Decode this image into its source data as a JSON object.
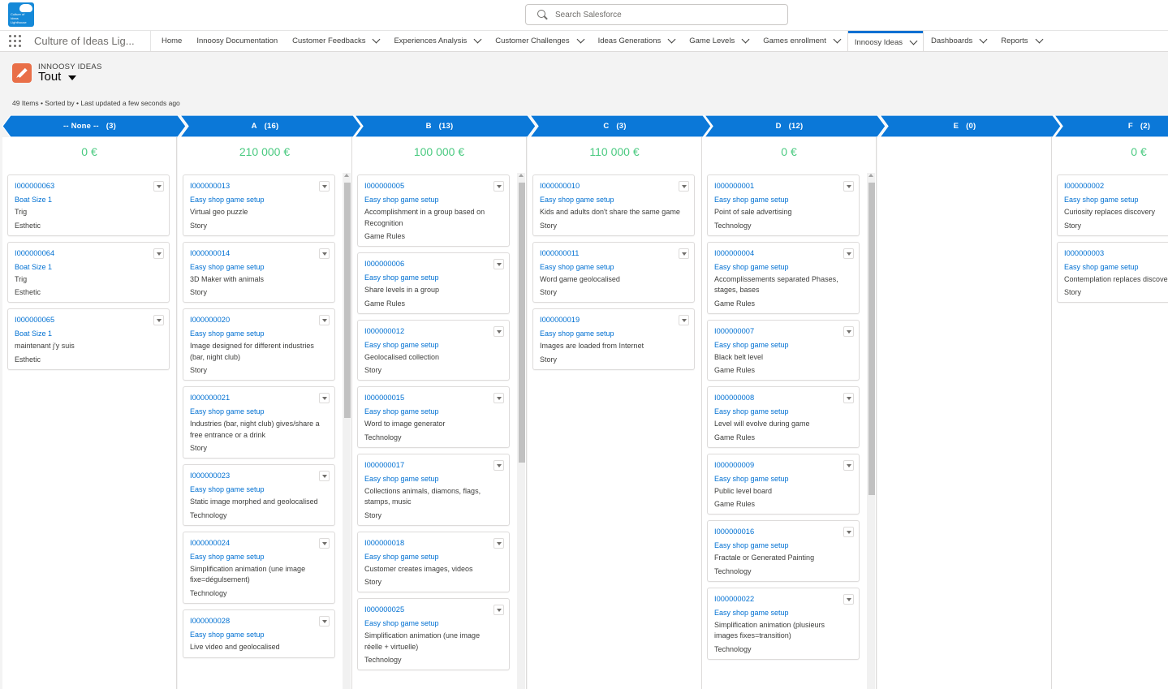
{
  "header": {
    "logo_text": "Culture of Ideas Lighthouse",
    "search_placeholder": "Search Salesforce"
  },
  "nav": {
    "app_name": "Culture of Ideas Lig...",
    "items": [
      {
        "label": "Home",
        "dropdown": false,
        "active": false
      },
      {
        "label": "Innoosy Documentation",
        "dropdown": false,
        "active": false
      },
      {
        "label": "Customer Feedbacks",
        "dropdown": true,
        "active": false
      },
      {
        "label": "Experiences Analysis",
        "dropdown": true,
        "active": false
      },
      {
        "label": "Customer Challenges",
        "dropdown": true,
        "active": false
      },
      {
        "label": "Ideas Generations",
        "dropdown": true,
        "active": false
      },
      {
        "label": "Game Levels",
        "dropdown": true,
        "active": false
      },
      {
        "label": "Games enrollment",
        "dropdown": true,
        "active": false
      },
      {
        "label": "Innoosy Ideas",
        "dropdown": true,
        "active": true
      },
      {
        "label": "Dashboards",
        "dropdown": true,
        "active": false
      },
      {
        "label": "Reports",
        "dropdown": true,
        "active": false
      }
    ]
  },
  "page": {
    "object_label": "INNOOSY IDEAS",
    "list_view": "Tout",
    "meta": "49 Items • Sorted by • Last updated a few seconds ago"
  },
  "kanban": {
    "columns": [
      {
        "stage": "-- None --",
        "count": "(3)",
        "total": "0 €",
        "scroll": false,
        "cards": [
          {
            "id": "I000000063",
            "f1": "Boat Size 1",
            "f2": "Trig",
            "f3": "Esthetic"
          },
          {
            "id": "I000000064",
            "f1": "Boat Size 1",
            "f2": "Trig",
            "f3": "Esthetic"
          },
          {
            "id": "I000000065",
            "f1": "Boat Size 1",
            "f2": "maintenant j'y suis",
            "f3": "Esthetic"
          }
        ]
      },
      {
        "stage": "A",
        "count": "(16)",
        "total": "210 000 €",
        "scroll": true,
        "cards": [
          {
            "id": "I000000013",
            "f1": "Easy shop game setup",
            "f2": "Virtual geo puzzle",
            "f3": "Story"
          },
          {
            "id": "I000000014",
            "f1": "Easy shop game setup",
            "f2": "3D Maker with animals",
            "f3": "Story"
          },
          {
            "id": "I000000020",
            "f1": "Easy shop game setup",
            "f2": "Image designed for different industries (bar, night club)",
            "f3": "Story"
          },
          {
            "id": "I000000021",
            "f1": "Easy shop game setup",
            "f2": "Industries (bar, night club) gives/share a free entrance or a drink",
            "f3": "Story"
          },
          {
            "id": "I000000023",
            "f1": "Easy shop game setup",
            "f2": "Static image morphed and geolocalised",
            "f3": "Technology"
          },
          {
            "id": "I000000024",
            "f1": "Easy shop game setup",
            "f2": "Simplification animation (une image fixe=dégulsement)",
            "f3": "Technology"
          },
          {
            "id": "I000000028",
            "f1": "Easy shop game setup",
            "f2": "Live video and geolocalised",
            "f3": ""
          }
        ]
      },
      {
        "stage": "B",
        "count": "(13)",
        "total": "100 000 €",
        "scroll": true,
        "cards": [
          {
            "id": "I000000005",
            "f1": "Easy shop game setup",
            "f2": "Accomplishment in a group based on Recognition",
            "f3": "Game Rules"
          },
          {
            "id": "I000000006",
            "f1": "Easy shop game setup",
            "f2": "Share levels in a group",
            "f3": "Game Rules"
          },
          {
            "id": "I000000012",
            "f1": "Easy shop game setup",
            "f2": "Geolocalised collection",
            "f3": "Story"
          },
          {
            "id": "I000000015",
            "f1": "Easy shop game setup",
            "f2": "Word to image generator",
            "f3": "Technology"
          },
          {
            "id": "I000000017",
            "f1": "Easy shop game setup",
            "f2": "Collections animals, diamons, flags, stamps, music",
            "f3": "Story"
          },
          {
            "id": "I000000018",
            "f1": "Easy shop game setup",
            "f2": "Customer creates images, videos",
            "f3": "Story"
          },
          {
            "id": "I000000025",
            "f1": "Easy shop game setup",
            "f2": "Simplification animation (une image réelle + virtuelle)",
            "f3": "Technology"
          }
        ]
      },
      {
        "stage": "C",
        "count": "(3)",
        "total": "110 000 €",
        "scroll": false,
        "cards": [
          {
            "id": "I000000010",
            "f1": "Easy shop game setup",
            "f2": "Kids and adults don't share the same game",
            "f3": "Story"
          },
          {
            "id": "I000000011",
            "f1": "Easy shop game setup",
            "f2": "Word game geolocalised",
            "f3": "Story"
          },
          {
            "id": "I000000019",
            "f1": "Easy shop game setup",
            "f2": "Images are loaded from Internet",
            "f3": "Story"
          }
        ]
      },
      {
        "stage": "D",
        "count": "(12)",
        "total": "0 €",
        "scroll": true,
        "cards": [
          {
            "id": "I000000001",
            "f1": "Easy shop game setup",
            "f2": "Point of sale advertising",
            "f3": "Technology"
          },
          {
            "id": "I000000004",
            "f1": "Easy shop game setup",
            "f2": "Accomplissements separated Phases, stages, bases",
            "f3": "Game Rules"
          },
          {
            "id": "I000000007",
            "f1": "Easy shop game setup",
            "f2": "Black belt level",
            "f3": "Game Rules"
          },
          {
            "id": "I000000008",
            "f1": "Easy shop game setup",
            "f2": "Level will evolve during game",
            "f3": "Game Rules"
          },
          {
            "id": "I000000009",
            "f1": "Easy shop game setup",
            "f2": "Public level board",
            "f3": "Game Rules"
          },
          {
            "id": "I000000016",
            "f1": "Easy shop game setup",
            "f2": "Fractale or Generated Painting",
            "f3": "Technology"
          },
          {
            "id": "I000000022",
            "f1": "Easy shop game setup",
            "f2": "Simplification animation (plusieurs images fixes=transition)",
            "f3": "Technology"
          }
        ]
      },
      {
        "stage": "E",
        "count": "(0)",
        "total": "",
        "scroll": false,
        "cards": []
      },
      {
        "stage": "F",
        "count": "(2)",
        "total": "0 €",
        "scroll": false,
        "cards": [
          {
            "id": "I000000002",
            "f1": "Easy shop game setup",
            "f2": "Curiosity replaces discovery",
            "f3": "Story"
          },
          {
            "id": "I000000003",
            "f1": "Easy shop game setup",
            "f2": "Contemplation replaces discovery",
            "f3": "Story"
          }
        ]
      }
    ]
  },
  "colors": {
    "brand_blue": "#0070d2",
    "stage_blue": "#0b78d8",
    "total_green": "#4bca81",
    "record_icon": "#e96f48"
  },
  "icons": [
    "waffle-icon",
    "search-icon",
    "chevron-down-icon",
    "pencil-icon",
    "list-view-caret-icon",
    "card-menu-icon"
  ]
}
